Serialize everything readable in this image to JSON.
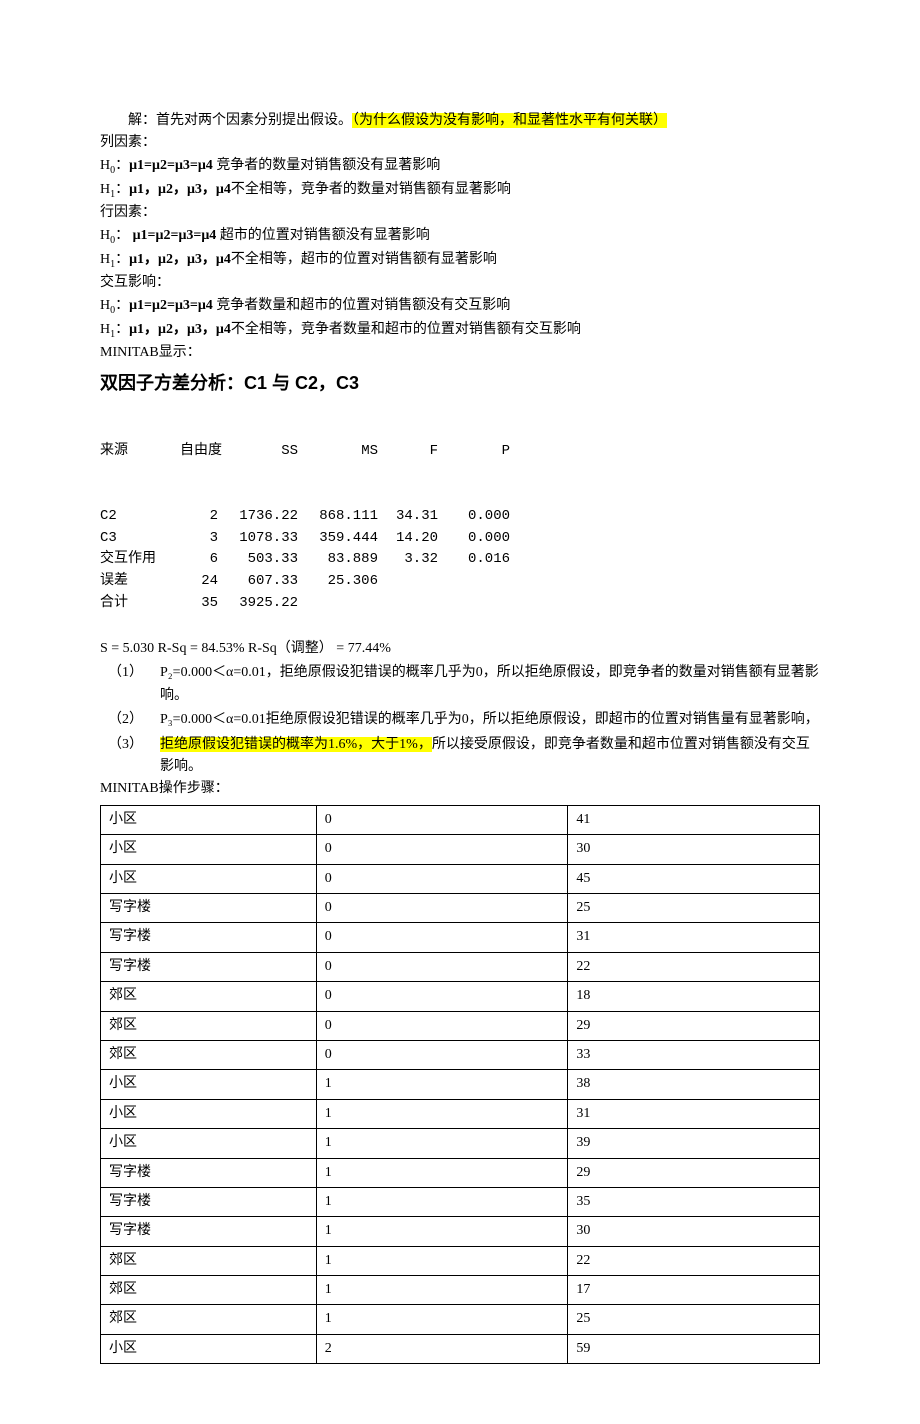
{
  "intro": {
    "line1_a": "解：首先对两个因素分别提出假设。",
    "line1_b": "（为什么假设为没有影响，和显著性水平有何关联）",
    "col_factor": "列因素：",
    "h0_col_a": "H",
    "h0_col_b": "0",
    "h0_col_c": "：",
    "h0_col_d": "μ1=μ2=μ3=μ4",
    "h0_col_e": " 竞争者的数量对销售额没有显著影响",
    "h1_col_a": "H",
    "h1_col_b": "1",
    "h1_col_c": "：",
    "h1_col_d": "μ1，μ2，μ3，μ4",
    "h1_col_e": "不全相等，竞争者的数量对销售额有显著影响",
    "row_factor": "行因素：",
    "h0_row_a": "H",
    "h0_row_b": "0",
    "h0_row_c": "：   ",
    "h0_row_d": "μ1=μ2=μ3=μ4",
    "h0_row_e": "    超市的位置对销售额没有显著影响",
    "h1_row_a": "H",
    "h1_row_b": "1",
    "h1_row_c": "：",
    "h1_row_d": "μ1，μ2，μ3，μ4",
    "h1_row_e": "不全相等，超市的位置对销售额有显著影响",
    "inter": "交互影响：",
    "h0_int_a": "H",
    "h0_int_b": "0",
    "h0_int_c": "：",
    "h0_int_d": "μ1=μ2=μ3=μ4",
    "h0_int_e": "        竞争者数量和超市的位置对销售额没有交互影响",
    "h1_int_a": "H",
    "h1_int_b": "1",
    "h1_int_c": "：",
    "h1_int_d": "μ1，μ2，μ3，μ4",
    "h1_int_e": "不全相等，竞争者数量和超市的位置对销售额有交互影响",
    "minitab": "MINITAB显示："
  },
  "anova": {
    "title": "双因子方差分析：C1 与 C2，C3",
    "hdr": {
      "src": "来源",
      "df": "自由度",
      "ss": "SS",
      "ms": "MS",
      "f": "F",
      "p": "P"
    },
    "rows": [
      {
        "src": "C2",
        "df": "2",
        "ss": "1736.22",
        "ms": "868.111",
        "f": "34.31",
        "p": "0.000"
      },
      {
        "src": "C3",
        "df": "3",
        "ss": "1078.33",
        "ms": "359.444",
        "f": "14.20",
        "p": "0.000"
      },
      {
        "src": "交互作用",
        "df": "6",
        "ss": "503.33",
        "ms": "83.889",
        "f": "3.32",
        "p": "0.016"
      },
      {
        "src": "误差",
        "df": "24",
        "ss": "607.33",
        "ms": "25.306",
        "f": "",
        "p": ""
      },
      {
        "src": "合计",
        "df": "35",
        "ss": "3925.22",
        "ms": "",
        "f": "",
        "p": ""
      }
    ],
    "rsq": "S = 5.030   R-Sq = 84.53%   R-Sq（调整） = 77.44%"
  },
  "conclusions": [
    {
      "n": "（1）",
      "t": "P₂=0.000＜α=0.01，拒绝原假设犯错误的概率几乎为0，所以拒绝原假设，即竞争者的数量对销售额有显著影响。"
    },
    {
      "n": "（2）",
      "t": "P₃=0.000＜α=0.01拒绝原假设犯错误的概率几乎为0，所以拒绝原假设，即超市的位置对销售量有显著影响，"
    },
    {
      "n": "（3）",
      "t_hi": "拒绝原假设犯错误的概率为1.6%，大于1%，",
      "t_rest": "所以接受原假设，即竞争者数量和超市位置对销售额没有交互影响。"
    }
  ],
  "steps_label": "MINITAB操作步骤：",
  "table_rows": [
    [
      "小区",
      "0",
      "41"
    ],
    [
      "小区",
      "0",
      "30"
    ],
    [
      "小区",
      "0",
      "45"
    ],
    [
      "写字楼",
      "0",
      "25"
    ],
    [
      "写字楼",
      "0",
      "31"
    ],
    [
      "写字楼",
      "0",
      "22"
    ],
    [
      "郊区",
      "0",
      "18"
    ],
    [
      "郊区",
      "0",
      "29"
    ],
    [
      "郊区",
      "0",
      "33"
    ],
    [
      "小区",
      "1",
      "38"
    ],
    [
      "小区",
      "1",
      "31"
    ],
    [
      "小区",
      "1",
      "39"
    ],
    [
      "写字楼",
      "1",
      "29"
    ],
    [
      "写字楼",
      "1",
      "35"
    ],
    [
      "写字楼",
      "1",
      "30"
    ],
    [
      "郊区",
      "1",
      "22"
    ],
    [
      "郊区",
      "1",
      "17"
    ],
    [
      "郊区",
      "1",
      "25"
    ],
    [
      "小区",
      "2",
      "59"
    ]
  ]
}
